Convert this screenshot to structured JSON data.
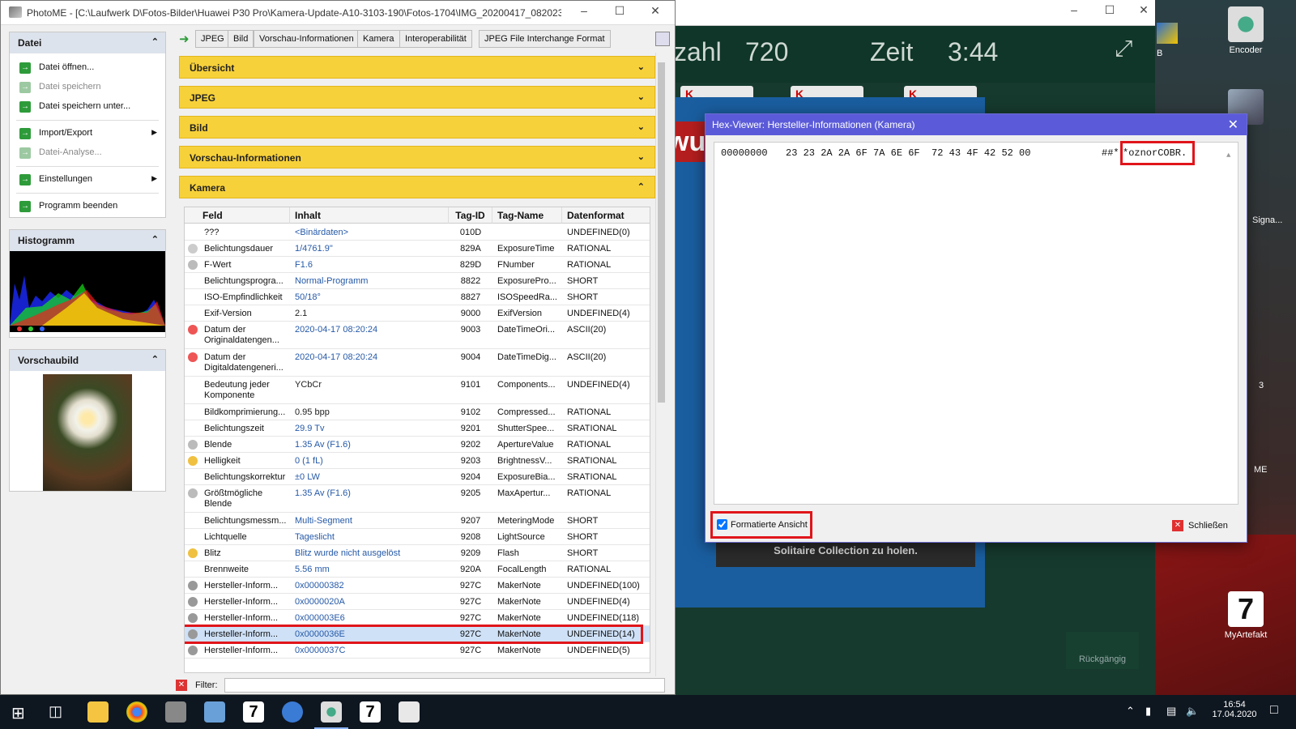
{
  "photome": {
    "title": "PhotoME - [C:\\Laufwerk  D\\Fotos-Bilder\\Huawei P30 Pro\\Kamera-Update-A10-3103-190\\Fotos-1704\\IMG_20200417_082023....",
    "panels": {
      "datei": {
        "title": "Datei",
        "items": [
          {
            "label": "Datei öffnen...",
            "enabled": true
          },
          {
            "label": "Datei speichern",
            "enabled": false
          },
          {
            "label": "Datei speichern unter...",
            "enabled": true
          },
          {
            "label": "Import/Export",
            "enabled": true,
            "submenu": true
          },
          {
            "label": "Datei-Analyse...",
            "enabled": false
          },
          {
            "label": "Einstellungen",
            "enabled": true,
            "submenu": true
          },
          {
            "label": "Programm beenden",
            "enabled": true
          }
        ]
      },
      "histogramm": {
        "title": "Histogramm"
      },
      "vorschau": {
        "title": "Vorschaubild"
      }
    },
    "toolbar": [
      "JPEG",
      "Bild",
      "Vorschau-Informationen",
      "Kamera",
      "Interoperabilität",
      "JPEG File Interchange Format"
    ],
    "sections": [
      {
        "label": "Übersicht",
        "expanded": false
      },
      {
        "label": "JPEG",
        "expanded": false
      },
      {
        "label": "Bild",
        "expanded": false
      },
      {
        "label": "Vorschau-Informationen",
        "expanded": false
      },
      {
        "label": "Kamera",
        "expanded": true
      }
    ],
    "table": {
      "headers": [
        "Feld",
        "Inhalt",
        "Tag-ID",
        "Tag-Name",
        "Datenformat"
      ],
      "rows": [
        [
          "???",
          "<Binärdaten>",
          "010D",
          "",
          "UNDEFINED(0)"
        ],
        [
          "Belichtungsdauer",
          "1/4761.9\"",
          "829A",
          "ExposureTime",
          "RATIONAL"
        ],
        [
          "F-Wert",
          "F1.6",
          "829D",
          "FNumber",
          "RATIONAL"
        ],
        [
          "Belichtungsprogra...",
          "Normal-Programm",
          "8822",
          "ExposurePro...",
          "SHORT"
        ],
        [
          "ISO-Empfindlichkeit",
          "50/18°",
          "8827",
          "ISOSpeedRa...",
          "SHORT"
        ],
        [
          "Exif-Version",
          "2.1",
          "9000",
          "ExifVersion",
          "UNDEFINED(4)"
        ],
        [
          "Datum der Originaldatengen...",
          "2020-04-17 08:20:24",
          "9003",
          "DateTimeOri...",
          "ASCII(20)"
        ],
        [
          "Datum der Digitaldatengeneri...",
          "2020-04-17 08:20:24",
          "9004",
          "DateTimeDig...",
          "ASCII(20)"
        ],
        [
          "Bedeutung jeder Komponente",
          "YCbCr",
          "9101",
          "Components...",
          "UNDEFINED(4)"
        ],
        [
          "Bildkomprimierung...",
          "0.95 bpp",
          "9102",
          "Compressed...",
          "RATIONAL"
        ],
        [
          "Belichtungszeit",
          "29.9 Tv",
          "9201",
          "ShutterSpee...",
          "SRATIONAL"
        ],
        [
          "Blende",
          "1.35 Av (F1.6)",
          "9202",
          "ApertureValue",
          "RATIONAL"
        ],
        [
          "Helligkeit",
          "0 (1 fL)",
          "9203",
          "BrightnessV...",
          "SRATIONAL"
        ],
        [
          "Belichtungskorrektur",
          "±0 LW",
          "9204",
          "ExposureBia...",
          "SRATIONAL"
        ],
        [
          "Größtmögliche Blende",
          "1.35 Av (F1.6)",
          "9205",
          "MaxApertur...",
          "RATIONAL"
        ],
        [
          "Belichtungsmessm...",
          "Multi-Segment",
          "9207",
          "MeteringMode",
          "SHORT"
        ],
        [
          "Lichtquelle",
          "Tageslicht",
          "9208",
          "LightSource",
          "SHORT"
        ],
        [
          "Blitz",
          "Blitz wurde nicht ausgelöst",
          "9209",
          "Flash",
          "SHORT"
        ],
        [
          "Brennweite",
          "5.56 mm",
          "920A",
          "FocalLength",
          "RATIONAL"
        ],
        [
          "Hersteller-Inform...",
          "0x00000382",
          "927C",
          "MakerNote",
          "UNDEFINED(100)"
        ],
        [
          "Hersteller-Inform...",
          "0x0000020A",
          "927C",
          "MakerNote",
          "UNDEFINED(4)"
        ],
        [
          "Hersteller-Inform...",
          "0x000003E6",
          "927C",
          "MakerNote",
          "UNDEFINED(118)"
        ],
        [
          "Hersteller-Inform...",
          "0x0000036E",
          "927C",
          "MakerNote",
          "UNDEFINED(14)"
        ],
        [
          "Hersteller-Inform...",
          "0x0000037C",
          "927C",
          "MakerNote",
          "UNDEFINED(5)"
        ]
      ],
      "selected_row": 22
    },
    "filter_label": "Filter:"
  },
  "hexviewer": {
    "title": "Hex-Viewer: Hersteller-Informationen (Kamera)",
    "offset": "00000000",
    "bytes": "23 23 2A 2A 6F 7A 6E 6F  72 43 4F 42 52 00",
    "ascii_prefix": "##*",
    "ascii_highlight": "*oznorCOBR.",
    "checkbox_label": "Formatierte Ansicht",
    "checkbox_checked": true,
    "close_label": "Schließen"
  },
  "background_game": {
    "hud_left": "zahl",
    "hud_count": "720",
    "hud_time_label": "Zeit",
    "hud_time": "3:44",
    "card_letter": "K",
    "banner": "wu",
    "message": "Solitaire Collection zu holen.",
    "undo": "Rückgängig"
  },
  "desktop_icons": [
    {
      "label": "Encoder"
    },
    {
      "label": "MyArtefakt"
    },
    {
      "label": "Signa..."
    },
    {
      "label": "B"
    },
    {
      "label": "3"
    },
    {
      "label": "ME"
    }
  ],
  "taskbar": {
    "time": "16:54",
    "date": "17.04.2020"
  },
  "colors": {
    "section_yellow": "#f7d13a",
    "hex_title_blue": "#5b5bd9",
    "highlight_red": "#e0151a",
    "link_blue": "#2559a8"
  }
}
